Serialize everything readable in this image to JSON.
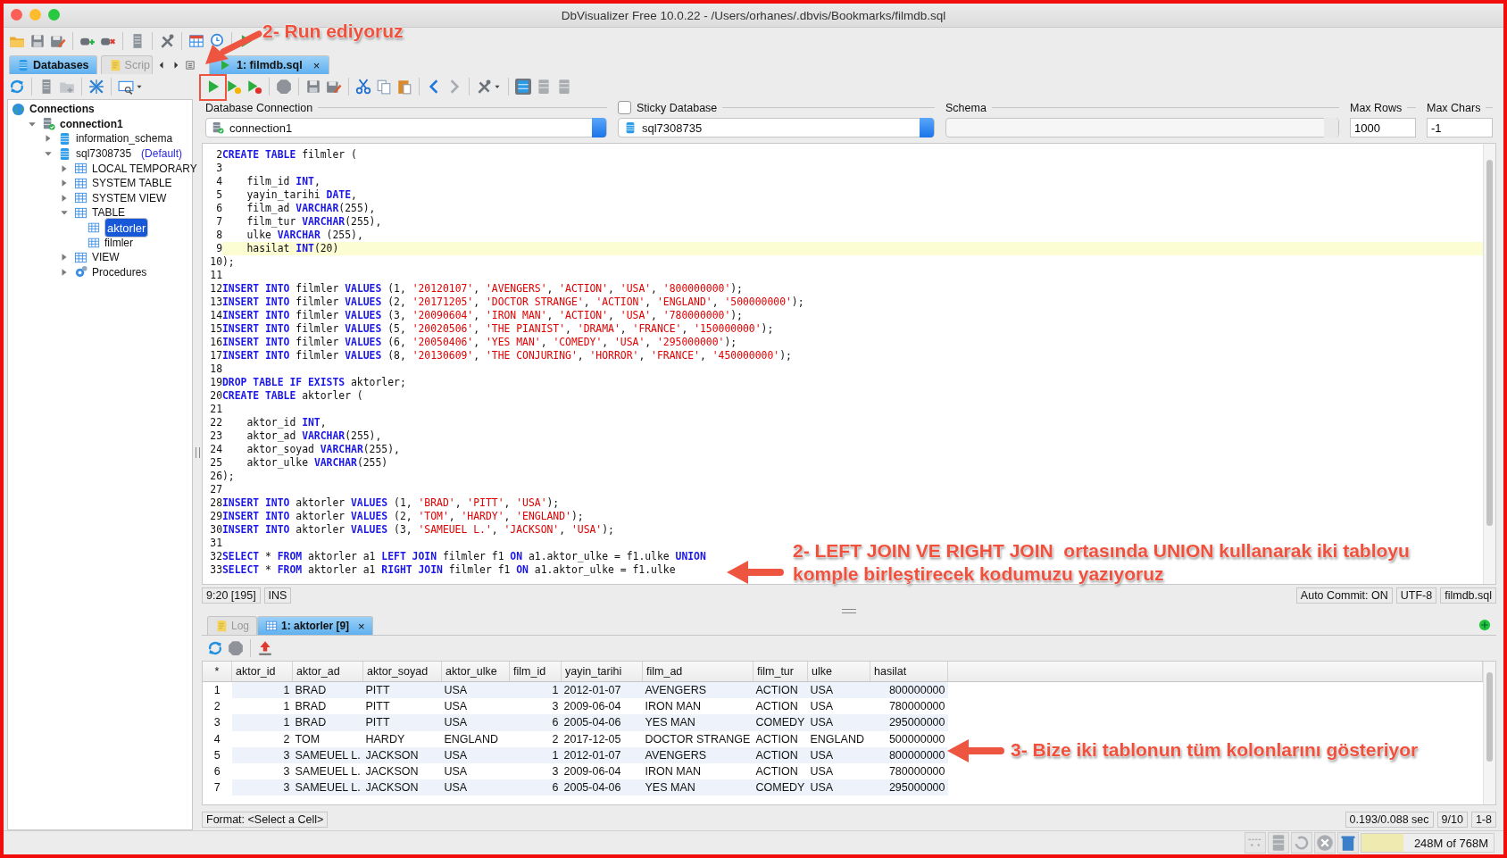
{
  "window": {
    "title": "DbVisualizer Free 10.0.22 - /Users/orhanes/.dbvis/Bookmarks/filmdb.sql"
  },
  "sidebar": {
    "tabs": [
      {
        "label": "Databases",
        "selected": true
      },
      {
        "label": "Scrip",
        "selected": false
      }
    ],
    "tree": [
      {
        "label": "Connections",
        "kind": "root",
        "selected": false,
        "children": [
          {
            "label": "connection1",
            "kind": "connection",
            "expanded": true,
            "selected": false,
            "children": [
              {
                "label": "information_schema",
                "kind": "schema",
                "expanded": false,
                "selected": false
              },
              {
                "label": "sql7308735",
                "suffix": "(Default)",
                "kind": "schema",
                "expanded": true,
                "selected": false,
                "children": [
                  {
                    "label": "LOCAL TEMPORARY",
                    "kind": "folder",
                    "expanded": false,
                    "selected": false
                  },
                  {
                    "label": "SYSTEM TABLE",
                    "kind": "folder",
                    "expanded": false,
                    "selected": false
                  },
                  {
                    "label": "SYSTEM VIEW",
                    "kind": "folder",
                    "expanded": false,
                    "selected": false
                  },
                  {
                    "label": "TABLE",
                    "kind": "folder",
                    "expanded": true,
                    "selected": false,
                    "children": [
                      {
                        "label": "aktorler",
                        "kind": "table",
                        "selected": true
                      },
                      {
                        "label": "filmler",
                        "kind": "table",
                        "selected": false
                      }
                    ]
                  },
                  {
                    "label": "VIEW",
                    "kind": "folder",
                    "expanded": false,
                    "selected": false
                  },
                  {
                    "label": "Procedures",
                    "kind": "procedures",
                    "expanded": false,
                    "selected": false
                  }
                ]
              }
            ]
          }
        ]
      }
    ]
  },
  "editor": {
    "tabs": [
      {
        "label": "1: filmdb.sql",
        "close": "×",
        "selected": true
      }
    ],
    "connection": {
      "label": "Database Connection",
      "value": "connection1"
    },
    "sticky": {
      "label": "Sticky Database",
      "checked": false
    },
    "database": {
      "value": "sql7308735"
    },
    "schema": {
      "label": "Schema"
    },
    "max_rows": {
      "label": "Max Rows",
      "value": "1000"
    },
    "max_chars": {
      "label": "Max Chars",
      "value": "-1"
    },
    "lines": [
      {
        "number": "2",
        "current": false,
        "tokens": [
          {
            "kind": "keyword",
            "text": "CREATE TABLE"
          },
          {
            "kind": "plain",
            "text": " filmler ("
          }
        ]
      },
      {
        "number": "3",
        "current": false
      },
      {
        "number": "4",
        "current": false,
        "tokens": [
          {
            "kind": "plain",
            "text": "    film_id "
          },
          {
            "kind": "keyword",
            "text": "INT"
          },
          {
            "kind": "plain",
            "text": ","
          }
        ]
      },
      {
        "number": "5",
        "current": false,
        "tokens": [
          {
            "kind": "plain",
            "text": "    yayin_tarihi "
          },
          {
            "kind": "keyword",
            "text": "DATE"
          },
          {
            "kind": "plain",
            "text": ","
          }
        ]
      },
      {
        "number": "6",
        "current": false,
        "tokens": [
          {
            "kind": "plain",
            "text": "    film_ad "
          },
          {
            "kind": "keyword",
            "text": "VARCHAR"
          },
          {
            "kind": "plain",
            "text": "(255),"
          }
        ]
      },
      {
        "number": "7",
        "current": false,
        "tokens": [
          {
            "kind": "plain",
            "text": "    film_tur "
          },
          {
            "kind": "keyword",
            "text": "VARCHAR"
          },
          {
            "kind": "plain",
            "text": "(255),"
          }
        ]
      },
      {
        "number": "8",
        "current": false,
        "tokens": [
          {
            "kind": "plain",
            "text": "    ulke "
          },
          {
            "kind": "keyword",
            "text": "VARCHAR"
          },
          {
            "kind": "plain",
            "text": " (255),"
          }
        ]
      },
      {
        "number": "9",
        "current": true,
        "tokens": [
          {
            "kind": "plain",
            "text": "    hasilat "
          },
          {
            "kind": "keyword",
            "text": "INT"
          },
          {
            "kind": "plain",
            "text": "(20)"
          }
        ]
      },
      {
        "number": "10",
        "current": false,
        "tokens": [
          {
            "kind": "plain",
            "text": ");"
          }
        ]
      },
      {
        "number": "11",
        "current": false
      },
      {
        "number": "12",
        "current": false,
        "tokens": [
          {
            "kind": "keyword",
            "text": "INSERT INTO"
          },
          {
            "kind": "plain",
            "text": " filmler "
          },
          {
            "kind": "keyword",
            "text": "VALUES"
          },
          {
            "kind": "plain",
            "text": " (1, "
          },
          {
            "kind": "string",
            "text": "'20120107'"
          },
          {
            "kind": "plain",
            "text": ", "
          },
          {
            "kind": "string",
            "text": "'AVENGERS'"
          },
          {
            "kind": "plain",
            "text": ", "
          },
          {
            "kind": "string",
            "text": "'ACTION'"
          },
          {
            "kind": "plain",
            "text": ", "
          },
          {
            "kind": "string",
            "text": "'USA'"
          },
          {
            "kind": "plain",
            "text": ", "
          },
          {
            "kind": "string",
            "text": "'800000000'"
          },
          {
            "kind": "plain",
            "text": ");"
          }
        ]
      },
      {
        "number": "13",
        "current": false,
        "tokens": [
          {
            "kind": "keyword",
            "text": "INSERT INTO"
          },
          {
            "kind": "plain",
            "text": " filmler "
          },
          {
            "kind": "keyword",
            "text": "VALUES"
          },
          {
            "kind": "plain",
            "text": " (2, "
          },
          {
            "kind": "string",
            "text": "'20171205'"
          },
          {
            "kind": "plain",
            "text": ", "
          },
          {
            "kind": "string",
            "text": "'DOCTOR STRANGE'"
          },
          {
            "kind": "plain",
            "text": ", "
          },
          {
            "kind": "string",
            "text": "'ACTION'"
          },
          {
            "kind": "plain",
            "text": ", "
          },
          {
            "kind": "string",
            "text": "'ENGLAND'"
          },
          {
            "kind": "plain",
            "text": ", "
          },
          {
            "kind": "string",
            "text": "'500000000'"
          },
          {
            "kind": "plain",
            "text": ");"
          }
        ]
      },
      {
        "number": "14",
        "current": false,
        "tokens": [
          {
            "kind": "keyword",
            "text": "INSERT INTO"
          },
          {
            "kind": "plain",
            "text": " filmler "
          },
          {
            "kind": "keyword",
            "text": "VALUES"
          },
          {
            "kind": "plain",
            "text": " (3, "
          },
          {
            "kind": "string",
            "text": "'20090604'"
          },
          {
            "kind": "plain",
            "text": ", "
          },
          {
            "kind": "string",
            "text": "'IRON MAN'"
          },
          {
            "kind": "plain",
            "text": ", "
          },
          {
            "kind": "string",
            "text": "'ACTION'"
          },
          {
            "kind": "plain",
            "text": ", "
          },
          {
            "kind": "string",
            "text": "'USA'"
          },
          {
            "kind": "plain",
            "text": ", "
          },
          {
            "kind": "string",
            "text": "'780000000'"
          },
          {
            "kind": "plain",
            "text": ");"
          }
        ]
      },
      {
        "number": "15",
        "current": false,
        "tokens": [
          {
            "kind": "keyword",
            "text": "INSERT INTO"
          },
          {
            "kind": "plain",
            "text": " filmler "
          },
          {
            "kind": "keyword",
            "text": "VALUES"
          },
          {
            "kind": "plain",
            "text": " (5, "
          },
          {
            "kind": "string",
            "text": "'20020506'"
          },
          {
            "kind": "plain",
            "text": ", "
          },
          {
            "kind": "string",
            "text": "'THE PIANIST'"
          },
          {
            "kind": "plain",
            "text": ", "
          },
          {
            "kind": "string",
            "text": "'DRAMA'"
          },
          {
            "kind": "plain",
            "text": ", "
          },
          {
            "kind": "string",
            "text": "'FRANCE'"
          },
          {
            "kind": "plain",
            "text": ", "
          },
          {
            "kind": "string",
            "text": "'150000000'"
          },
          {
            "kind": "plain",
            "text": ");"
          }
        ]
      },
      {
        "number": "16",
        "current": false,
        "tokens": [
          {
            "kind": "keyword",
            "text": "INSERT INTO"
          },
          {
            "kind": "plain",
            "text": " filmler "
          },
          {
            "kind": "keyword",
            "text": "VALUES"
          },
          {
            "kind": "plain",
            "text": " (6, "
          },
          {
            "kind": "string",
            "text": "'20050406'"
          },
          {
            "kind": "plain",
            "text": ", "
          },
          {
            "kind": "string",
            "text": "'YES MAN'"
          },
          {
            "kind": "plain",
            "text": ", "
          },
          {
            "kind": "string",
            "text": "'COMEDY'"
          },
          {
            "kind": "plain",
            "text": ", "
          },
          {
            "kind": "string",
            "text": "'USA'"
          },
          {
            "kind": "plain",
            "text": ", "
          },
          {
            "kind": "string",
            "text": "'295000000'"
          },
          {
            "kind": "plain",
            "text": ");"
          }
        ]
      },
      {
        "number": "17",
        "current": false,
        "tokens": [
          {
            "kind": "keyword",
            "text": "INSERT INTO"
          },
          {
            "kind": "plain",
            "text": " filmler "
          },
          {
            "kind": "keyword",
            "text": "VALUES"
          },
          {
            "kind": "plain",
            "text": " (8, "
          },
          {
            "kind": "string",
            "text": "'20130609'"
          },
          {
            "kind": "plain",
            "text": ", "
          },
          {
            "kind": "string",
            "text": "'THE CONJURING'"
          },
          {
            "kind": "plain",
            "text": ", "
          },
          {
            "kind": "string",
            "text": "'HORROR'"
          },
          {
            "kind": "plain",
            "text": ", "
          },
          {
            "kind": "string",
            "text": "'FRANCE'"
          },
          {
            "kind": "plain",
            "text": ", "
          },
          {
            "kind": "string",
            "text": "'450000000'"
          },
          {
            "kind": "plain",
            "text": ");"
          }
        ]
      },
      {
        "number": "18",
        "current": false
      },
      {
        "number": "19",
        "current": false,
        "tokens": [
          {
            "kind": "keyword",
            "text": "DROP TABLE IF EXISTS"
          },
          {
            "kind": "plain",
            "text": " aktorler;"
          }
        ]
      },
      {
        "number": "20",
        "current": false,
        "tokens": [
          {
            "kind": "keyword",
            "text": "CREATE TABLE"
          },
          {
            "kind": "plain",
            "text": " aktorler ("
          }
        ]
      },
      {
        "number": "21",
        "current": false
      },
      {
        "number": "22",
        "current": false,
        "tokens": [
          {
            "kind": "plain",
            "text": "    aktor_id "
          },
          {
            "kind": "keyword",
            "text": "INT"
          },
          {
            "kind": "plain",
            "text": ","
          }
        ]
      },
      {
        "number": "23",
        "current": false,
        "tokens": [
          {
            "kind": "plain",
            "text": "    aktor_ad "
          },
          {
            "kind": "keyword",
            "text": "VARCHAR"
          },
          {
            "kind": "plain",
            "text": "(255),"
          }
        ]
      },
      {
        "number": "24",
        "current": false,
        "tokens": [
          {
            "kind": "plain",
            "text": "    aktor_soyad "
          },
          {
            "kind": "keyword",
            "text": "VARCHAR"
          },
          {
            "kind": "plain",
            "text": "(255),"
          }
        ]
      },
      {
        "number": "25",
        "current": false,
        "tokens": [
          {
            "kind": "plain",
            "text": "    aktor_ulke "
          },
          {
            "kind": "keyword",
            "text": "VARCHAR"
          },
          {
            "kind": "plain",
            "text": "(255)"
          }
        ]
      },
      {
        "number": "26",
        "current": false,
        "tokens": [
          {
            "kind": "plain",
            "text": ");"
          }
        ]
      },
      {
        "number": "27",
        "current": false
      },
      {
        "number": "28",
        "current": false,
        "tokens": [
          {
            "kind": "keyword",
            "text": "INSERT INTO"
          },
          {
            "kind": "plain",
            "text": " aktorler "
          },
          {
            "kind": "keyword",
            "text": "VALUES"
          },
          {
            "kind": "plain",
            "text": " (1, "
          },
          {
            "kind": "string",
            "text": "'BRAD'"
          },
          {
            "kind": "plain",
            "text": ", "
          },
          {
            "kind": "string",
            "text": "'PITT'"
          },
          {
            "kind": "plain",
            "text": ", "
          },
          {
            "kind": "string",
            "text": "'USA'"
          },
          {
            "kind": "plain",
            "text": ");"
          }
        ]
      },
      {
        "number": "29",
        "current": false,
        "tokens": [
          {
            "kind": "keyword",
            "text": "INSERT INTO"
          },
          {
            "kind": "plain",
            "text": " aktorler "
          },
          {
            "kind": "keyword",
            "text": "VALUES"
          },
          {
            "kind": "plain",
            "text": " (2, "
          },
          {
            "kind": "string",
            "text": "'TOM'"
          },
          {
            "kind": "plain",
            "text": ", "
          },
          {
            "kind": "string",
            "text": "'HARDY'"
          },
          {
            "kind": "plain",
            "text": ", "
          },
          {
            "kind": "string",
            "text": "'ENGLAND'"
          },
          {
            "kind": "plain",
            "text": ");"
          }
        ]
      },
      {
        "number": "30",
        "current": false,
        "tokens": [
          {
            "kind": "keyword",
            "text": "INSERT INTO"
          },
          {
            "kind": "plain",
            "text": " aktorler "
          },
          {
            "kind": "keyword",
            "text": "VALUES"
          },
          {
            "kind": "plain",
            "text": " (3, "
          },
          {
            "kind": "string",
            "text": "'SAMEUEL L.'"
          },
          {
            "kind": "plain",
            "text": ", "
          },
          {
            "kind": "string",
            "text": "'JACKSON'"
          },
          {
            "kind": "plain",
            "text": ", "
          },
          {
            "kind": "string",
            "text": "'USA'"
          },
          {
            "kind": "plain",
            "text": ");"
          }
        ]
      },
      {
        "number": "31",
        "current": false
      },
      {
        "number": "32",
        "current": false,
        "tokens": [
          {
            "kind": "keyword",
            "text": "SELECT"
          },
          {
            "kind": "plain",
            "text": " * "
          },
          {
            "kind": "keyword",
            "text": "FROM"
          },
          {
            "kind": "plain",
            "text": " aktorler a1 "
          },
          {
            "kind": "keyword",
            "text": "LEFT JOIN"
          },
          {
            "kind": "plain",
            "text": " filmler f1 "
          },
          {
            "kind": "keyword",
            "text": "ON"
          },
          {
            "kind": "plain",
            "text": " a1.aktor_ulke = f1.ulke "
          },
          {
            "kind": "keyword",
            "text": "UNION"
          }
        ]
      },
      {
        "number": "33",
        "current": false,
        "tokens": [
          {
            "kind": "keyword",
            "text": "SELECT"
          },
          {
            "kind": "plain",
            "text": " * "
          },
          {
            "kind": "keyword",
            "text": "FROM"
          },
          {
            "kind": "plain",
            "text": " aktorler a1 "
          },
          {
            "kind": "keyword",
            "text": "RIGHT JOIN"
          },
          {
            "kind": "plain",
            "text": " filmler f1 "
          },
          {
            "kind": "keyword",
            "text": "ON"
          },
          {
            "kind": "plain",
            "text": " a1.aktor_ulke = f1.ulke"
          }
        ]
      }
    ],
    "status": {
      "position": "9:20 [195]",
      "mode": "INS",
      "auto_commit": "Auto Commit: ON",
      "encoding": "UTF-8",
      "file": "filmdb.sql"
    }
  },
  "results": {
    "tabs": [
      {
        "label": "Log",
        "selected": false
      },
      {
        "label": "1: aktorler [9]",
        "close": "×",
        "selected": true
      }
    ],
    "table": {
      "corner": "*",
      "columns": [
        {
          "name": "aktor_id",
          "numeric": true
        },
        {
          "name": "aktor_ad",
          "numeric": false
        },
        {
          "name": "aktor_soyad",
          "numeric": false
        },
        {
          "name": "aktor_ulke",
          "numeric": false
        },
        {
          "name": "film_id",
          "numeric": true
        },
        {
          "name": "yayin_tarihi",
          "numeric": false
        },
        {
          "name": "film_ad",
          "numeric": false
        },
        {
          "name": "film_tur",
          "numeric": false
        },
        {
          "name": "ulke",
          "numeric": false
        },
        {
          "name": "hasilat",
          "numeric": true
        }
      ],
      "rows": [
        {
          "number": "1",
          "cells": [
            "1",
            "BRAD",
            "PITT",
            "USA",
            "1",
            "2012-01-07",
            "AVENGERS",
            "ACTION",
            "USA",
            "800000000"
          ]
        },
        {
          "number": "2",
          "cells": [
            "1",
            "BRAD",
            "PITT",
            "USA",
            "3",
            "2009-06-04",
            "IRON MAN",
            "ACTION",
            "USA",
            "780000000"
          ]
        },
        {
          "number": "3",
          "cells": [
            "1",
            "BRAD",
            "PITT",
            "USA",
            "6",
            "2005-04-06",
            "YES MAN",
            "COMEDY",
            "USA",
            "295000000"
          ]
        },
        {
          "number": "4",
          "cells": [
            "2",
            "TOM",
            "HARDY",
            "ENGLAND",
            "2",
            "2017-12-05",
            "DOCTOR STRANGE",
            "ACTION",
            "ENGLAND",
            "500000000"
          ]
        },
        {
          "number": "5",
          "cells": [
            "3",
            "SAMEUEL L.",
            "JACKSON",
            "USA",
            "1",
            "2012-01-07",
            "AVENGERS",
            "ACTION",
            "USA",
            "800000000"
          ]
        },
        {
          "number": "6",
          "cells": [
            "3",
            "SAMEUEL L.",
            "JACKSON",
            "USA",
            "3",
            "2009-06-04",
            "IRON MAN",
            "ACTION",
            "USA",
            "780000000"
          ]
        },
        {
          "number": "7",
          "cells": [
            "3",
            "SAMEUEL L.",
            "JACKSON",
            "USA",
            "6",
            "2005-04-06",
            "YES MAN",
            "COMEDY",
            "USA",
            "295000000"
          ]
        }
      ]
    },
    "format": "Format: <Select a Cell>",
    "timing": "0.193/0.088 sec",
    "rows_count": "9/10",
    "range": "1-8"
  },
  "status_bar": {
    "memory": "248M of 768M",
    "level": 0.32
  },
  "annotations": [
    {
      "text": "2- Run ediyoruz"
    },
    {
      "text": "2- LEFT JOIN VE RIGHT JOIN  ortasında UNION kullanarak iki tabloyu komple birleştirecek kodumuzu yazıyoruz"
    },
    {
      "text": "3- Bize iki tablonun tüm kolonlarını gösteriyor"
    }
  ]
}
